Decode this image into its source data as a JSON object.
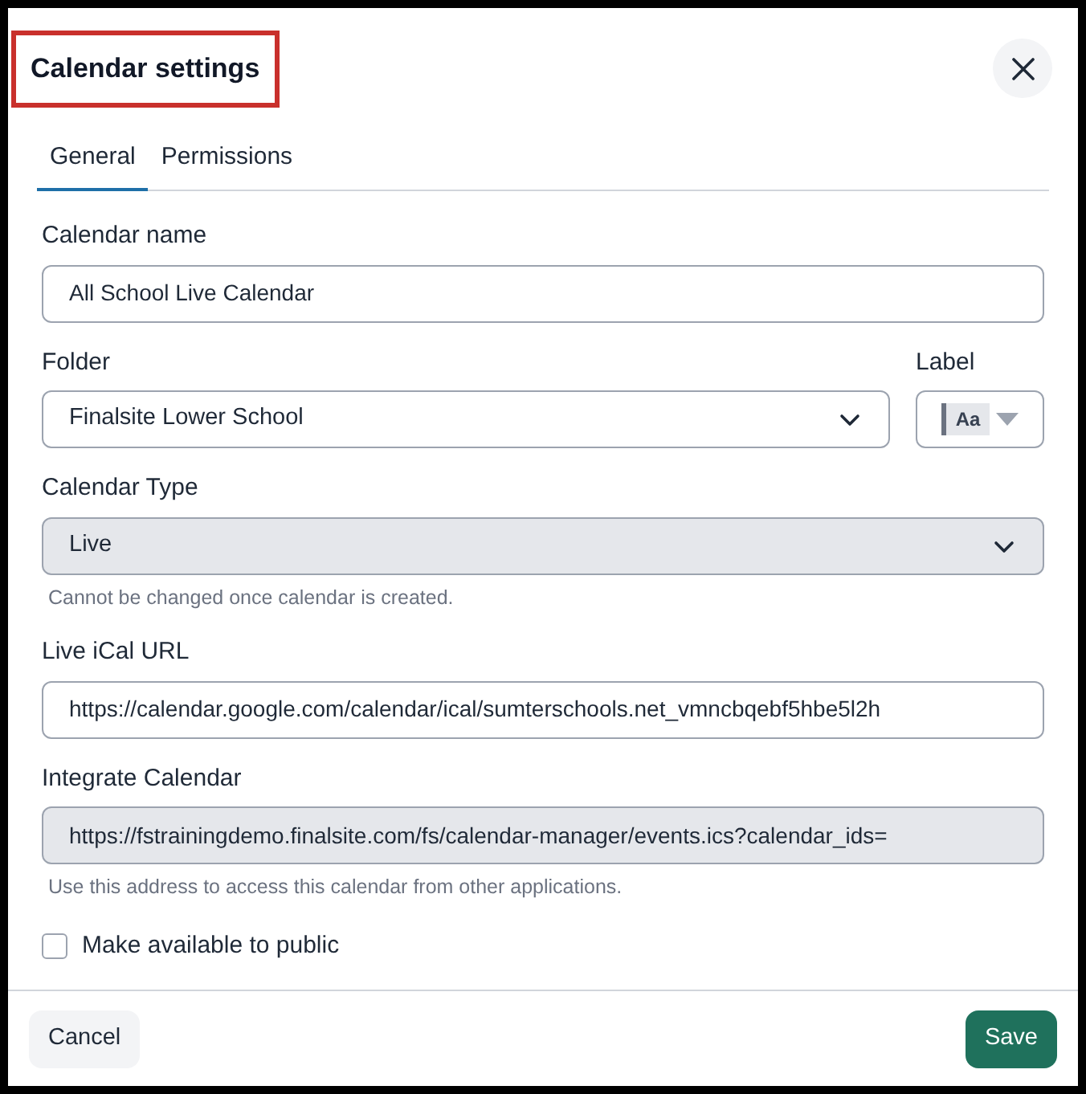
{
  "dialog": {
    "title": "Calendar settings",
    "title_highlighted": true
  },
  "tabs": [
    {
      "label": "General",
      "selected": true
    },
    {
      "label": "Permissions",
      "selected": false
    }
  ],
  "fields": [
    {
      "kind": "text",
      "label": "Calendar name",
      "value": "All School Live Calendar",
      "disabled": false
    },
    {
      "kind": "folder",
      "label": "Folder",
      "value": "Finalsite Lower School",
      "side_label": "Label",
      "side_value": "Aa"
    },
    {
      "kind": "select",
      "label": "Calendar Type",
      "value": "Live",
      "disabled": true,
      "help": "Cannot be changed once calendar is created."
    },
    {
      "kind": "text",
      "label": "Live iCal URL",
      "value": "https://calendar.google.com/calendar/ical/sumterschools.net_vmncbqebf5hbe5l2h",
      "disabled": false
    },
    {
      "kind": "text",
      "label": "Integrate Calendar",
      "value": "https://fstrainingdemo.finalsite.com/fs/calendar-manager/events.ics?calendar_ids=",
      "disabled": true,
      "help": "Use this address to access this calendar from other applications."
    }
  ],
  "public_checkbox": {
    "label": "Make available to public",
    "checked": false
  },
  "footer": {
    "cancel": "Cancel",
    "save": "Save"
  }
}
